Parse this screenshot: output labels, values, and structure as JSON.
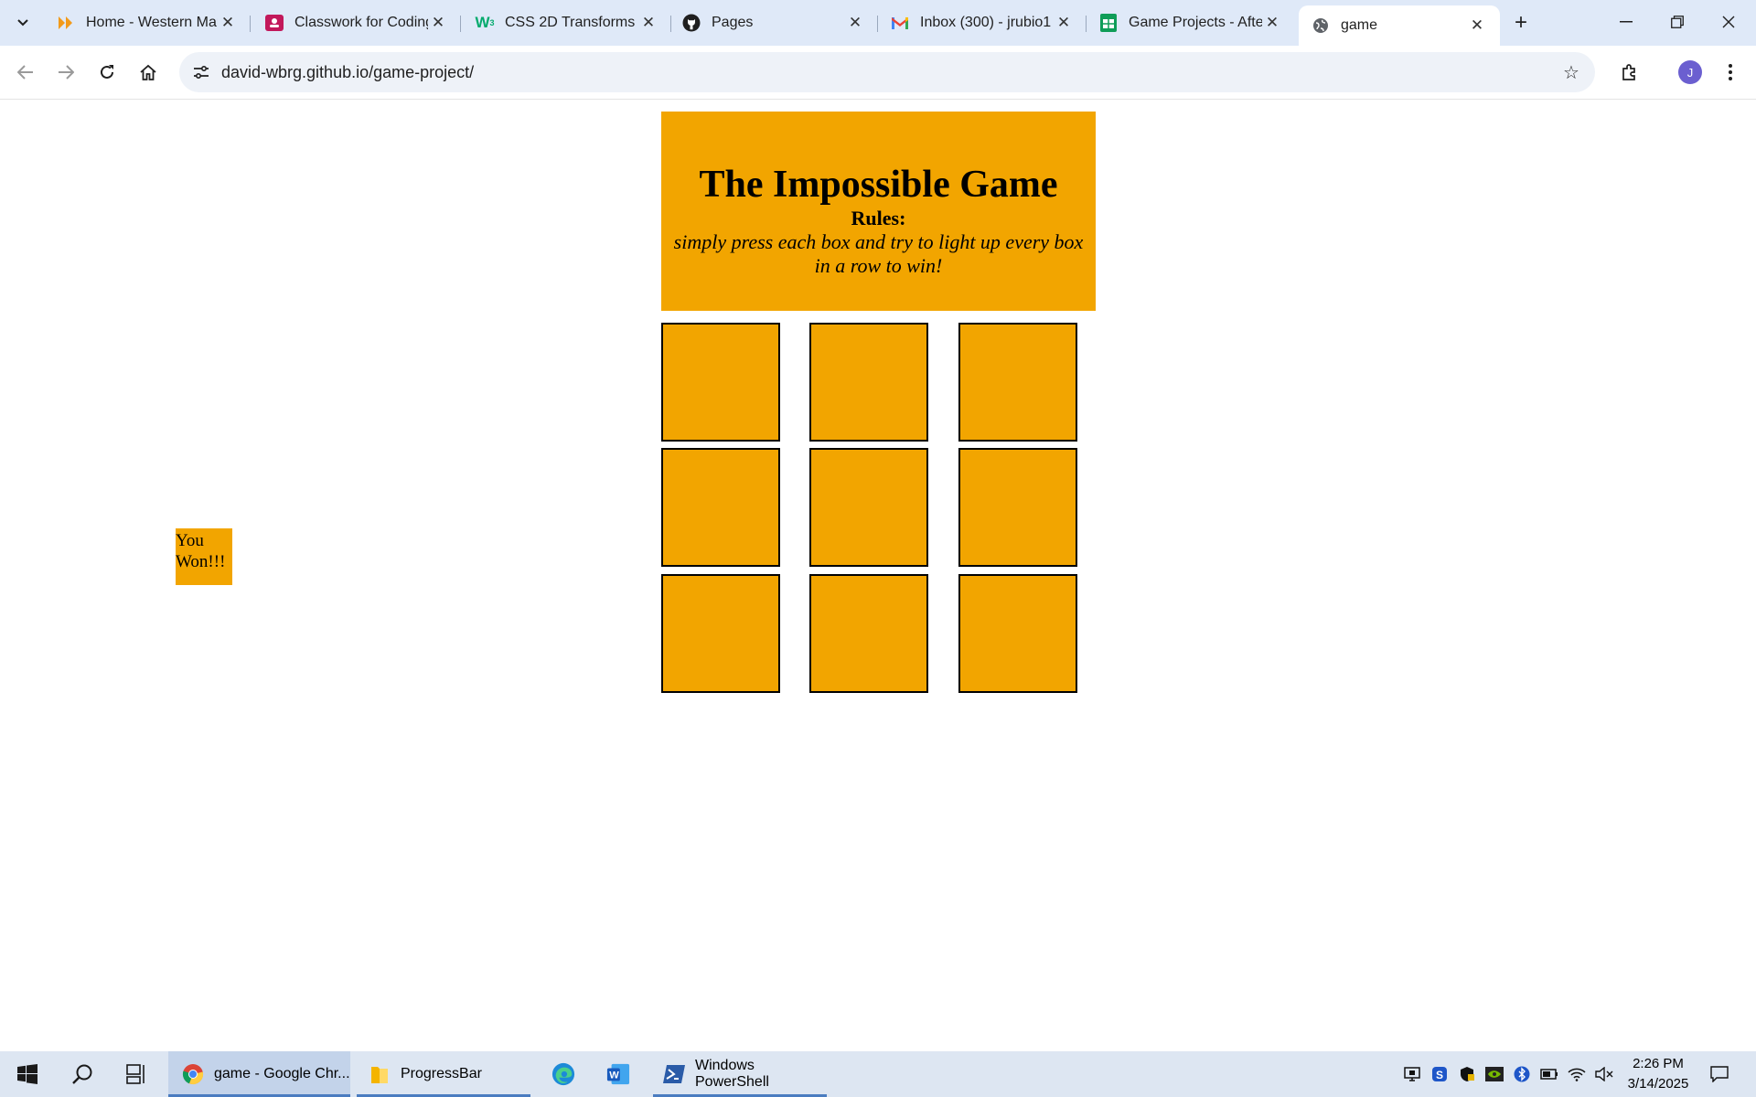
{
  "browser": {
    "tabs": [
      {
        "title": "Home - Western Mar",
        "icon": "double-chevron-icon"
      },
      {
        "title": "Classwork for Coding",
        "icon": "classroom-icon"
      },
      {
        "title": "CSS 2D Transforms",
        "icon": "w3schools-icon"
      },
      {
        "title": "Pages",
        "icon": "github-icon"
      },
      {
        "title": "Inbox (300) - jrubio1",
        "icon": "gmail-icon"
      },
      {
        "title": "Game Projects - Afte",
        "icon": "sheets-icon"
      },
      {
        "title": "game",
        "icon": "globe-icon",
        "active": true
      }
    ],
    "url": "david-wbrg.github.io/game-project/",
    "profile_initial": "J"
  },
  "page": {
    "title": "The Impossible Game",
    "rules_label": "Rules:",
    "rules_text": "simply press each box and try to light up every box in a row to win!",
    "won_text": "You Won!!!",
    "box_color": "#f2a500",
    "grid_rows": 3,
    "grid_cols": 3
  },
  "taskbar": {
    "items": [
      {
        "label": "game - Google Chr...",
        "icon": "chrome-icon",
        "active": true
      },
      {
        "label": "ProgressBar",
        "icon": "folder-icon"
      },
      {
        "label": "",
        "icon": "edge-icon"
      },
      {
        "label": "",
        "icon": "word-icon"
      },
      {
        "label": "Windows PowerShell",
        "icon": "powershell-icon"
      }
    ],
    "time": "2:26 PM",
    "date": "3/14/2025"
  }
}
